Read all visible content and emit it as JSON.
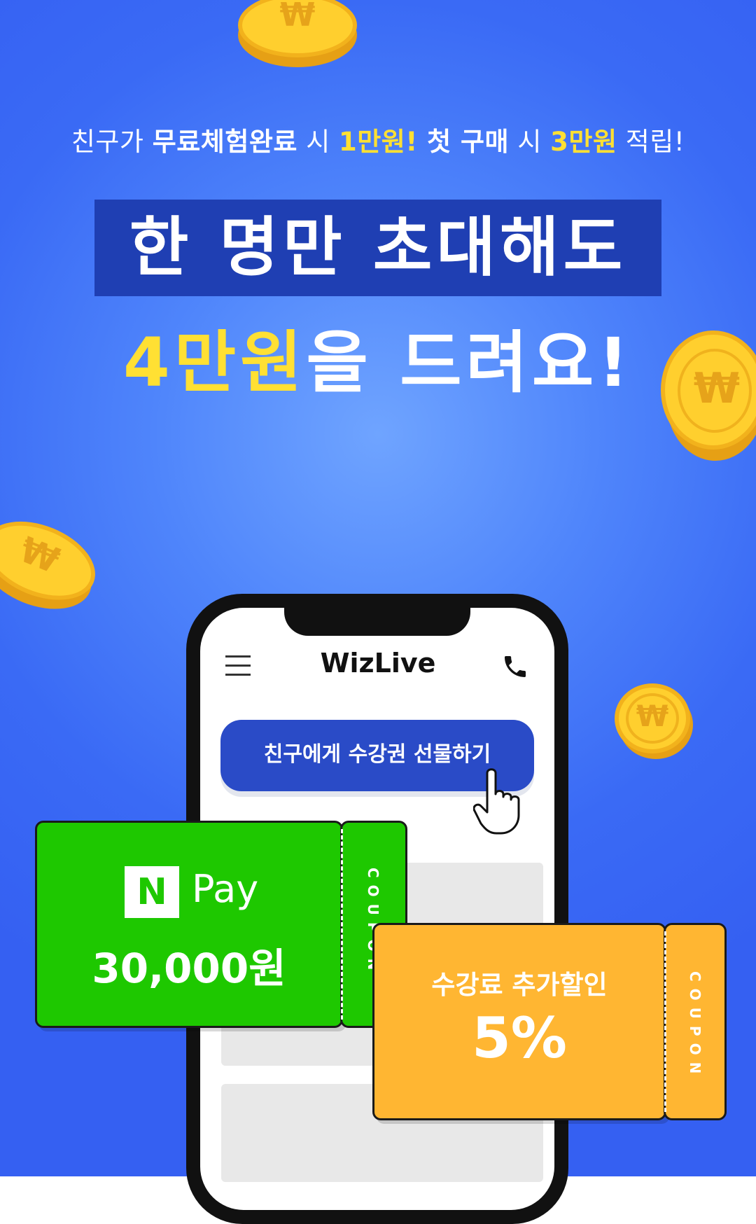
{
  "colors": {
    "background": "#4a7ef9",
    "highlight_yellow": "#ffe033",
    "headline_box": "#1f3fb3",
    "naverpay_green": "#1ec800",
    "coupon_orange": "#ffb632",
    "button_blue": "#2a4bc7"
  },
  "promo": {
    "subtitle": {
      "part1": "친구가 ",
      "part2": "무료체험완료",
      "part3": " 시 ",
      "part4": "1만원!",
      "part5": " 첫 구매",
      "part6": " 시 ",
      "part7": "3만원",
      "part8": " 적립!"
    },
    "headline_line1": "한 명만 초대해도",
    "headline_line2_highlight": "4만원",
    "headline_line2_rest": "을 드려요!"
  },
  "phone": {
    "logo": "WizLive",
    "gift_button": "친구에게 수강권 선물하기",
    "icons": [
      "menu-icon",
      "phone-call-icon",
      "pointer-hand-icon"
    ]
  },
  "coupons": {
    "naverpay": {
      "logo_letter": "N",
      "logo_text": "Pay",
      "amount": "30,000원",
      "stub_label": "COUPON"
    },
    "discount": {
      "title": "수강료 추가할인",
      "value": "5%",
      "stub_label": "COUPON"
    }
  },
  "coin_symbol": "₩"
}
